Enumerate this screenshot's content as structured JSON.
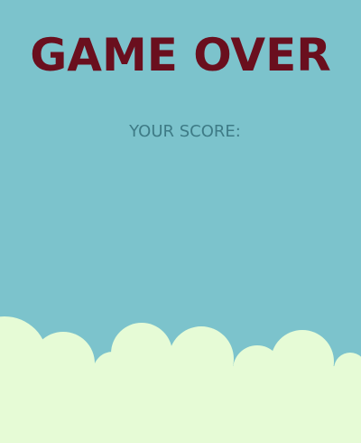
{
  "game_over": {
    "title": "GAME OVER",
    "score_label": "YOUR SCORE:",
    "score_value": ""
  },
  "colors": {
    "sky": "#7cc3cc",
    "title": "#6a0f1e",
    "score_label": "#3e7b86",
    "cloud": "#e6fbd6"
  }
}
